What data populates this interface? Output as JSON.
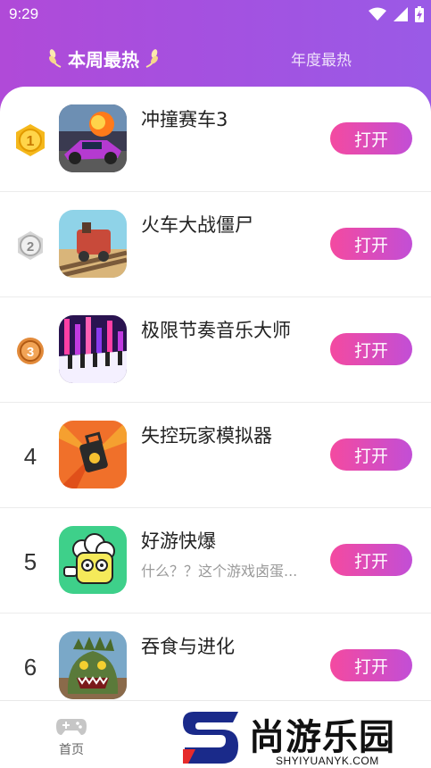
{
  "status_bar": {
    "time": "9:29"
  },
  "tabs": {
    "week": "本周最热",
    "year": "年度最热"
  },
  "apps": [
    {
      "rank": "1",
      "name": "冲撞赛车3",
      "desc": "",
      "button": "打开"
    },
    {
      "rank": "2",
      "name": "火车大战僵尸",
      "desc": "",
      "button": "打开"
    },
    {
      "rank": "3",
      "name": "极限节奏音乐大师",
      "desc": "",
      "button": "打开"
    },
    {
      "rank": "4",
      "name": "失控玩家模拟器",
      "desc": "",
      "button": "打开"
    },
    {
      "rank": "5",
      "name": "好游快爆",
      "desc": "什么？？这个游戏卤蛋...",
      "button": "打开"
    },
    {
      "rank": "6",
      "name": "吞食与进化",
      "desc": "",
      "button": "打开"
    }
  ],
  "bottom_nav": {
    "home": "首页"
  },
  "watermark": {
    "title": "尚游乐园",
    "url": "SHYIYUANYK.COM"
  },
  "colors": {
    "header_start": "#b04ad8",
    "header_end": "#9a5ae6",
    "button_start": "#f44aa0",
    "button_end": "#c24ed6"
  }
}
